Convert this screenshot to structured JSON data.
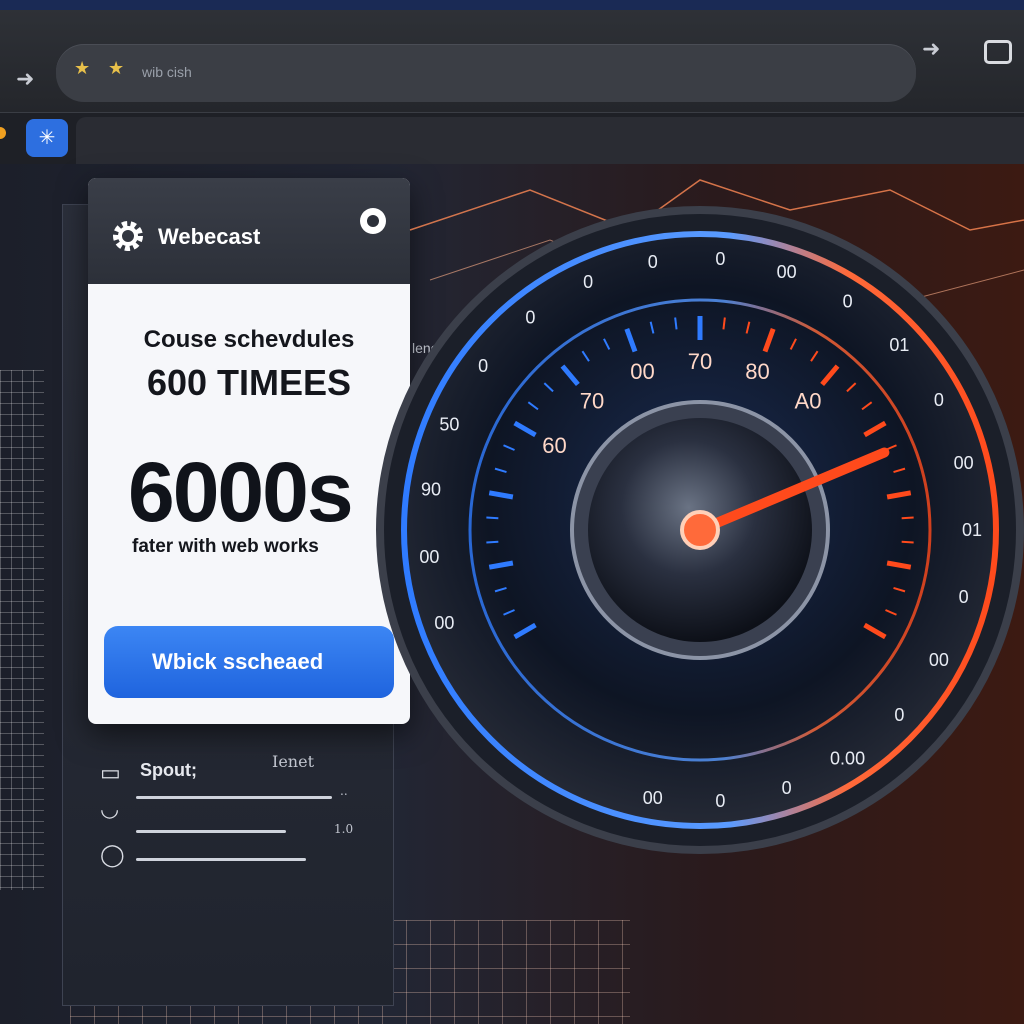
{
  "browser": {
    "url_text": "wib cish",
    "icons": [
      "back-arrow-icon",
      "star-icon",
      "forward-arrow-icon",
      "window-icon",
      "extension-icon"
    ]
  },
  "page": {
    "side_label": "lenes"
  },
  "card": {
    "app_name": "Webecast",
    "subtitle": "Couse schevdules",
    "title": "600 TIMEES",
    "big_value": "6000s",
    "tagline": "fater with web works",
    "button_label": "Wbick sscheaed"
  },
  "list": {
    "label": "Spout;",
    "meta": "Ienet",
    "sub_meta_1": "..",
    "sub_meta_2": "1.0"
  },
  "gauge": {
    "outer_ticks": [
      "00",
      "00",
      "90",
      "50",
      "0",
      "0",
      "0",
      "0",
      "0",
      "00",
      "0",
      "01",
      "0",
      "00",
      "01",
      "0",
      "00",
      "0",
      "0.00",
      "0",
      "0",
      "00"
    ],
    "scale_labels": [
      "60",
      "70",
      "00",
      "70",
      "80",
      "A0"
    ],
    "needle_percent": 78,
    "colors": {
      "cool": "#2f7bff",
      "hot": "#ff4a1c",
      "glow": "#ff8a55"
    }
  }
}
